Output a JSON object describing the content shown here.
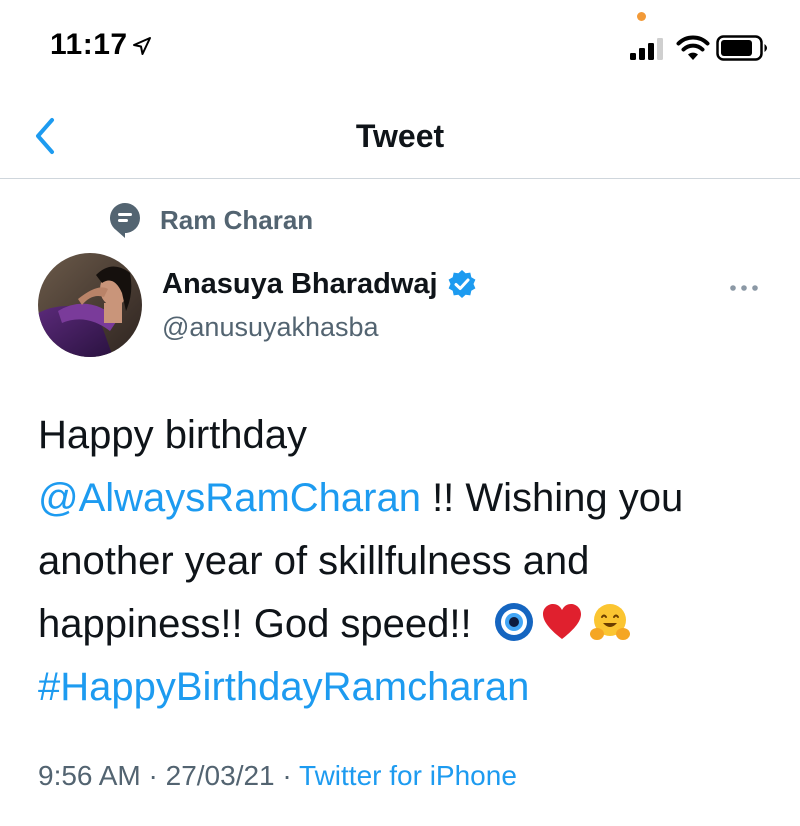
{
  "status_bar": {
    "time": "11:17"
  },
  "nav": {
    "title": "Tweet"
  },
  "reply_context": {
    "name": "Ram Charan"
  },
  "author": {
    "display_name": "Anasuya Bharadwaj",
    "handle": "@anusuyakhasba",
    "verified": true
  },
  "tweet": {
    "text_line1": "Happy birthday",
    "mention": "@AlwaysRamCharan",
    "text_after_mention": " !! Wishing you another year of skillfulness and happiness!! God speed!!",
    "emojis": [
      "nazar-amulet-icon",
      "red-heart-icon",
      "hugging-face-icon"
    ],
    "hashtag": "#HappyBirthdayRamcharan"
  },
  "meta": {
    "time": "9:56 AM",
    "separator1": " · ",
    "date": "27/03/21",
    "separator2": " · ",
    "source": "Twitter for iPhone"
  },
  "colors": {
    "link": "#1d9bf0",
    "muted": "#536471",
    "text": "#0f1419",
    "divider": "#cfd6dc",
    "indicator_dot": "#f29a38"
  }
}
